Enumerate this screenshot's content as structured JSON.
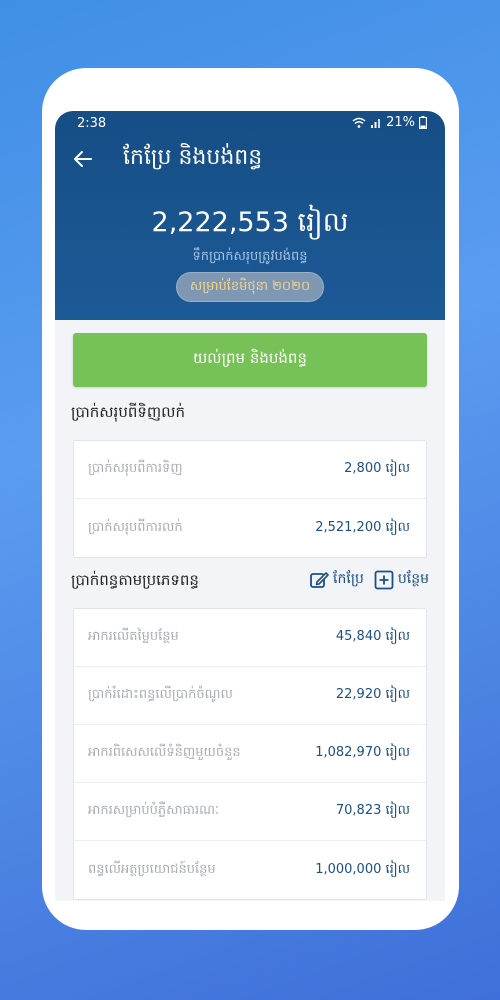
{
  "status_bar": {
    "time": "2:38",
    "battery": "21%"
  },
  "header": {
    "title": "កែប្រែ និងបង់ពន្ធ",
    "amount": "2,222,553 រៀល",
    "amount_caption": "ទឹកប្រាក់សរុបត្រូវបង់ពន្ធ",
    "month_label": "សម្រាប់ខែមិថុនា ២០២០"
  },
  "agree_button": "យល់ព្រម និងបង់ពន្ធ",
  "summary": {
    "title": "ប្រាក់សរុបពីទិញលក់",
    "rows": [
      {
        "label": "ប្រាក់សរុបពីការទិញ",
        "value": "2,800 រៀល"
      },
      {
        "label": "ប្រាក់សរុបពីការលក់",
        "value": "2,521,200 រៀល"
      }
    ]
  },
  "tax_types": {
    "title": "ប្រាក់ពន្ធតាមប្រភេទពន្ធ",
    "edit_label": "កែប្រែ",
    "add_label": "បន្ថែម",
    "rows": [
      {
        "label": "អាករលើតម្លៃបន្ថែម",
        "value": "45,840 រៀល"
      },
      {
        "label": "ប្រាក់រំដោះពន្ធលើប្រាក់ចំណូល",
        "value": "22,920 រៀល"
      },
      {
        "label": "អាករពិសេសលើទំនិញមួយចំនួន",
        "value": "1,082,970 រៀល"
      },
      {
        "label": "អាករសម្រាប់បំភ្លឺសាធារណៈ",
        "value": "70,823 រៀល"
      },
      {
        "label": "ពន្ធលើអត្ថប្រយោជន៍បន្ថែម",
        "value": "1,000,000 រៀល"
      }
    ]
  },
  "colors": {
    "header_blue": "#1c5a96",
    "button_green": "#76c257",
    "value_blue": "#1c4f85",
    "pill_text": "#f3d58b"
  }
}
